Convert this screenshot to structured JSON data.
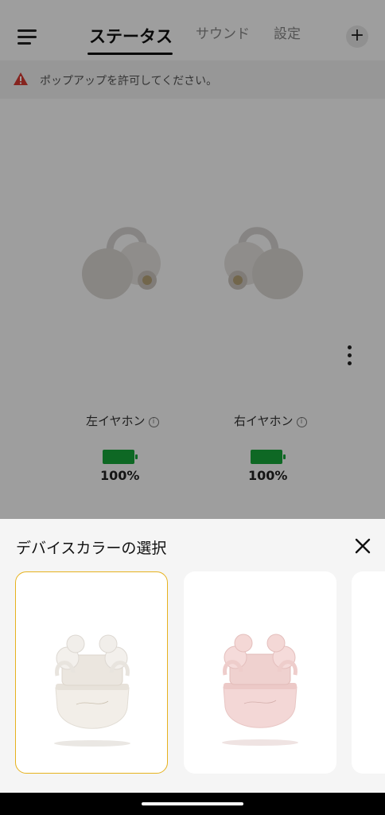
{
  "header": {
    "tabs": [
      {
        "label": "ステータス",
        "active": true
      },
      {
        "label": "サウンド",
        "active": false
      },
      {
        "label": "設定",
        "active": false
      }
    ],
    "add_icon": "plus-icon",
    "menu_icon": "menu-icon"
  },
  "alert": {
    "icon": "warning-icon",
    "text": "ポップアップを許可してください。",
    "color": "#d93a32"
  },
  "status": {
    "left": {
      "label": "左イヤホン",
      "battery": "100%",
      "level": 1.0
    },
    "right": {
      "label": "右イヤホン",
      "battery": "100%",
      "level": 1.0
    },
    "battery_color": "#18a83a"
  },
  "sheet": {
    "title": "デバイスカラーの選択",
    "close_icon": "close-icon",
    "options": [
      {
        "color_name": "white",
        "case_color": "#f2eee8",
        "selected": true
      },
      {
        "color_name": "pink",
        "case_color": "#f3d7d6",
        "selected": false
      }
    ],
    "selected_border": "#e6b21e"
  }
}
